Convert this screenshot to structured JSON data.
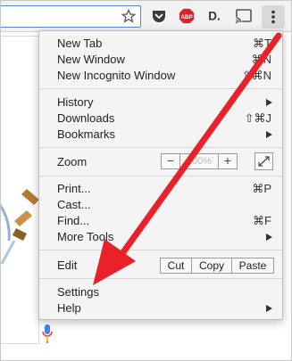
{
  "menu": {
    "section1": [
      {
        "label": "New Tab",
        "shortcut": "⌘T"
      },
      {
        "label": "New Window",
        "shortcut": "⌘N"
      },
      {
        "label": "New Incognito Window",
        "shortcut": "⇧⌘N"
      }
    ],
    "section2": [
      {
        "label": "History",
        "submenu": true
      },
      {
        "label": "Downloads",
        "shortcut": "⇧⌘J"
      },
      {
        "label": "Bookmarks",
        "submenu": true
      }
    ],
    "zoom": {
      "label": "Zoom",
      "minus": "−",
      "value": "100%",
      "plus": "+"
    },
    "section4": [
      {
        "label": "Print...",
        "shortcut": "⌘P"
      },
      {
        "label": "Cast..."
      },
      {
        "label": "Find...",
        "shortcut": "⌘F"
      },
      {
        "label": "More Tools",
        "submenu": true
      }
    ],
    "edit": {
      "label": "Edit",
      "cut": "Cut",
      "copy": "Copy",
      "paste": "Paste"
    },
    "section6": [
      {
        "label": "Settings"
      },
      {
        "label": "Help",
        "submenu": true
      }
    ]
  },
  "toolbar": {
    "icons": [
      "star-icon",
      "pocket-icon",
      "adblock-plus-icon",
      "extension-d-icon",
      "cast-icon",
      "menu-kebab-icon"
    ],
    "abp_text": "ABP",
    "d_text": "D."
  },
  "colors": {
    "annotation_arrow": "#e8212b",
    "abp": "#d8232a",
    "pocket": "#3a3a3a"
  }
}
